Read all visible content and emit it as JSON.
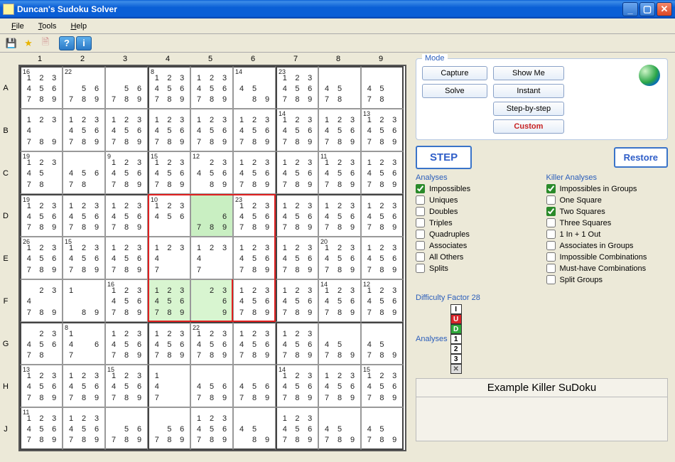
{
  "window": {
    "title": "Duncan's Sudoku Solver"
  },
  "menu": {
    "file": "File",
    "tools": "Tools",
    "help": "Help"
  },
  "toolbar": {
    "save": "save-icon",
    "star": "star-icon",
    "doc": "doc-icon",
    "help": "?",
    "info": "i"
  },
  "mode": {
    "legend": "Mode",
    "capture": "Capture",
    "solve": "Solve",
    "showme": "Show Me",
    "instant": "Instant",
    "stepbystep": "Step-by-step",
    "custom": "Custom"
  },
  "step_button": "STEP",
  "restore_button": "Restore",
  "analyses": {
    "legend": "Analyses",
    "items": [
      {
        "label": "Impossibles",
        "checked": true
      },
      {
        "label": "Uniques",
        "checked": false
      },
      {
        "label": "Doubles",
        "checked": false
      },
      {
        "label": "Triples",
        "checked": false
      },
      {
        "label": "Quadruples",
        "checked": false
      },
      {
        "label": "Associates",
        "checked": false
      },
      {
        "label": "All Others",
        "checked": false
      },
      {
        "label": "Splits",
        "checked": false
      }
    ]
  },
  "killer_analyses": {
    "legend": "Killer Analyses",
    "items": [
      {
        "label": "Impossibles in Groups",
        "checked": true
      },
      {
        "label": "One Square",
        "checked": false
      },
      {
        "label": "Two Squares",
        "checked": true
      },
      {
        "label": "Three Squares",
        "checked": false
      },
      {
        "label": "1 In + 1 Out",
        "checked": false
      },
      {
        "label": "Associates in Groups",
        "checked": false
      },
      {
        "label": "Impossible Combinations",
        "checked": false
      },
      {
        "label": "Must-have Combinations",
        "checked": false
      },
      {
        "label": "Split Groups",
        "checked": false
      }
    ]
  },
  "difficulty_factor": {
    "label": "Difficulty Factor",
    "value": "28"
  },
  "analysis_indicators": {
    "label": "Analyses",
    "squares": [
      "I",
      "U",
      "D",
      "1",
      "2",
      "3",
      "✕"
    ]
  },
  "status": {
    "title": "Example Killer SuDoku"
  },
  "grid": {
    "col_labels": [
      "1",
      "2",
      "3",
      "4",
      "5",
      "6",
      "7",
      "8",
      "9"
    ],
    "row_labels": [
      "A",
      "B",
      "C",
      "D",
      "E",
      "F",
      "G",
      "H",
      "J"
    ],
    "cages": {
      "A1": "16",
      "A2": "22",
      "A4": "8",
      "A6": "14",
      "A7": "23",
      "B7": "14",
      "B9": "13",
      "C1": "19",
      "C3": "9",
      "C4": "15",
      "C5": "12",
      "C8": "11",
      "D1": "19",
      "D4": "10",
      "D6": "23",
      "E1": "26",
      "E2": "15",
      "E8": "20",
      "F3": "16",
      "F8": "14",
      "F9": "12",
      "G2": "8",
      "G5": "22",
      "H1": "13",
      "H3": "15",
      "H7": "14",
      "H9": "15",
      "J1": "11"
    },
    "default_candidates": [
      1,
      2,
      3,
      4,
      5,
      6,
      7,
      8,
      9
    ],
    "candidate_overrides": {
      "A2": [
        5,
        6,
        7,
        8,
        9
      ],
      "A3": [
        5,
        6,
        7,
        8,
        9
      ],
      "A6": [
        4,
        5,
        8,
        9
      ],
      "A8": [
        4,
        5,
        7,
        8
      ],
      "A9": [
        4,
        5,
        7,
        8
      ],
      "B1": [
        1,
        2,
        3,
        4,
        7,
        8,
        9
      ],
      "C1": [
        1,
        2,
        3,
        4,
        5,
        7,
        8
      ],
      "C2": [
        4,
        5,
        6,
        7,
        8
      ],
      "C5": [
        2,
        3,
        4,
        5,
        6,
        8,
        9
      ],
      "D4": [
        1,
        2,
        3,
        4,
        5,
        6
      ],
      "D5": [
        6,
        7,
        8,
        9
      ],
      "E4": [
        1,
        2,
        3,
        4,
        7
      ],
      "E5": [
        1,
        2,
        3,
        4,
        7
      ],
      "F1": [
        2,
        3,
        4,
        7,
        8,
        9
      ],
      "F2": [
        1,
        8,
        9
      ],
      "F4": [
        1,
        2,
        3,
        4,
        5,
        6,
        7,
        8,
        9
      ],
      "F5": [
        2,
        3,
        6,
        9
      ],
      "G1": [
        2,
        3,
        4,
        5,
        6,
        7,
        8
      ],
      "G2": [
        1,
        4,
        6,
        7
      ],
      "G8": [
        4,
        5,
        7,
        8,
        9
      ],
      "G9": [
        4,
        5,
        7,
        8,
        9
      ],
      "H4": [
        1,
        4,
        7
      ],
      "H5": [
        4,
        5,
        6,
        7,
        8,
        9
      ],
      "H6": [
        4,
        5,
        6,
        7,
        8,
        9
      ],
      "J3": [
        5,
        6,
        7,
        8,
        9
      ],
      "J4": [
        5,
        6,
        7,
        8,
        9
      ],
      "J6": [
        4,
        5,
        8,
        9
      ],
      "J8": [
        4,
        5,
        7,
        8,
        9
      ],
      "J9": [
        4,
        5,
        7,
        8,
        9
      ]
    },
    "highlighted_green": [
      "D5",
      "F4",
      "F5"
    ],
    "red_polyomino_cells": [
      "D4",
      "D5",
      "D6",
      "E4",
      "E5",
      "E6",
      "F4",
      "F5",
      "F6"
    ]
  }
}
